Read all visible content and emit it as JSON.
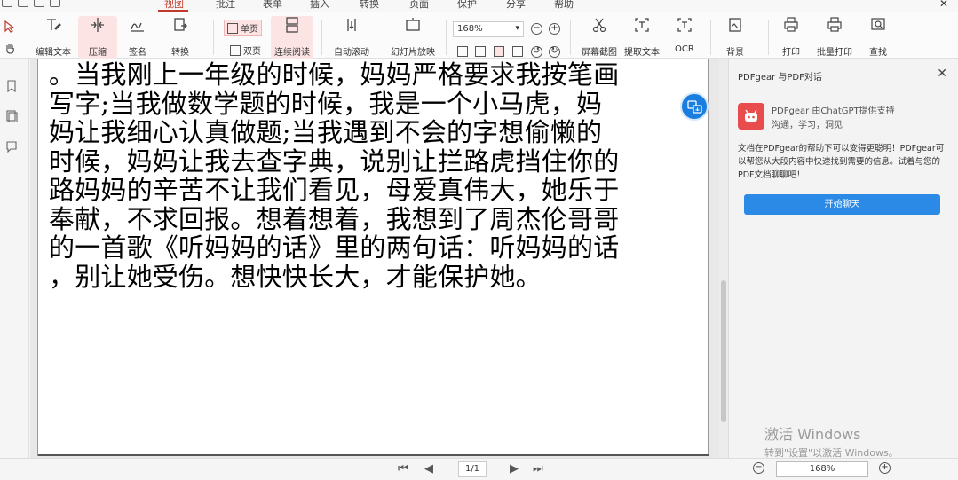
{
  "menubar": {
    "tabs": [
      {
        "label": "视图",
        "active": true
      },
      {
        "label": "批注",
        "active": false
      },
      {
        "label": "表单",
        "active": false
      },
      {
        "label": "插入",
        "active": false
      },
      {
        "label": "转换",
        "active": false
      },
      {
        "label": "页面",
        "active": false
      },
      {
        "label": "保护",
        "active": false
      },
      {
        "label": "分享",
        "active": false
      },
      {
        "label": "帮助",
        "active": false
      }
    ]
  },
  "toolbar": {
    "edit_text": "编辑文本",
    "compress": "压缩",
    "sign": "签名",
    "convert": "转换",
    "single_page": "单页",
    "double_page": "双页",
    "continuous_read": "连续阅读",
    "auto_scroll": "自动滚动",
    "slideshow": "幻灯片放映",
    "zoom_value": "168%",
    "screenshot": "屏幕截图",
    "extract_text": "提取文本",
    "ocr": "OCR",
    "background": "背景",
    "print": "打印",
    "batch_print": "批量打印",
    "find": "查找"
  },
  "document": {
    "lines": [
      "。当我刚上一年级的时候，妈妈严格要求我按笔画",
      "写字;当我做数学题的时候，我是一个小马虎，妈",
      "妈让我细心认真做题;当我遇到不会的字想偷懒的",
      "时候，妈妈让我去查字典，说别让拦路虎挡住你的",
      "路妈妈的辛苦不让我们看见，母爱真伟大，她乐于",
      "奉献，不求回报。想着想着，我想到了周杰伦哥哥",
      "的一首歌《听妈妈的话》里的两句话：听妈妈的话",
      "，别让她受伤。想快快长大，才能保护她。"
    ]
  },
  "chat_panel": {
    "title": "PDFgear 与PDF对话",
    "bot_name": "PDFgear  由ChatGPT提供支持",
    "tagline": "沟通，学习，洞见",
    "message": "文档在PDFgear的帮助下可以变得更聪明！PDFgear可以帮您从大段内容中快速找到需要的信息。试着与您的PDF文档聊聊吧！",
    "start_button": "开始聊天"
  },
  "watermark": {
    "line1": "激活 Windows",
    "line2": "转到\"设置\"以激活 Windows。"
  },
  "statusbar": {
    "page_indicator": "1/1",
    "zoom": "168%"
  },
  "colors": {
    "accent_red": "#c0392b",
    "chat_button_blue": "#2b8ae6",
    "translate_fab_blue": "#1a7de0",
    "bot_avatar_red": "#e84c4c"
  }
}
